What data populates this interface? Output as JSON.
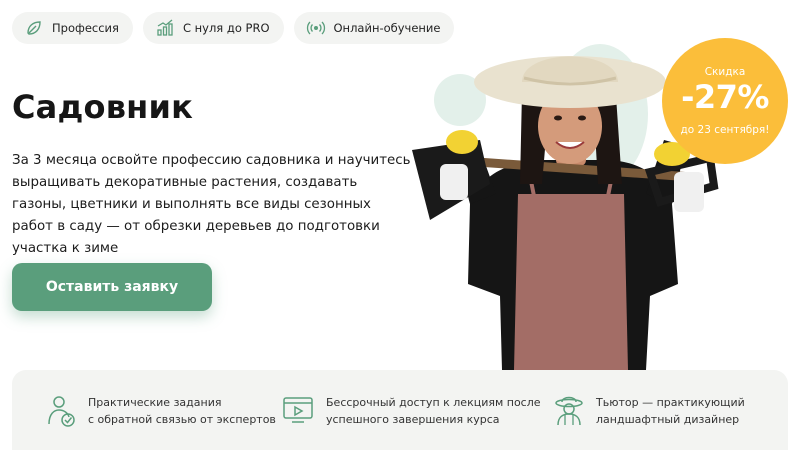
{
  "tags": [
    {
      "label": "Профессия",
      "icon": "leaf-icon"
    },
    {
      "label": "С нуля до PRO",
      "icon": "growth-chart-icon"
    },
    {
      "label": "Онлайн-обучение",
      "icon": "broadcast-icon"
    }
  ],
  "hero": {
    "title": "Садовник",
    "description": "За 3 месяца освойте профессию садовника и научитесь выращивать декоративные растения, создавать газоны, цветники и выполнять все виды сезонных работ в саду — от обрезки деревьев до подготовки участка к зиме",
    "cta_label": "Оставить заявку"
  },
  "badge": {
    "label": "Скидка",
    "value": "-27%",
    "sub": "до 23 сентября!"
  },
  "features": [
    {
      "line1": "Практические задания",
      "line2": "с обратной связью от экспертов",
      "icon": "expert-check-icon"
    },
    {
      "line1": "Бессрочный доступ к лекциям после",
      "line2": "успешного завершения курса",
      "icon": "video-lecture-icon"
    },
    {
      "line1": "Тьютор — практикующий",
      "line2": "ландшафтный дизайнер",
      "icon": "gardener-hat-icon"
    }
  ],
  "colors": {
    "accent": "#5a9e7c",
    "badge": "#fbbe3a",
    "tag_bg": "#f3f4f2"
  }
}
